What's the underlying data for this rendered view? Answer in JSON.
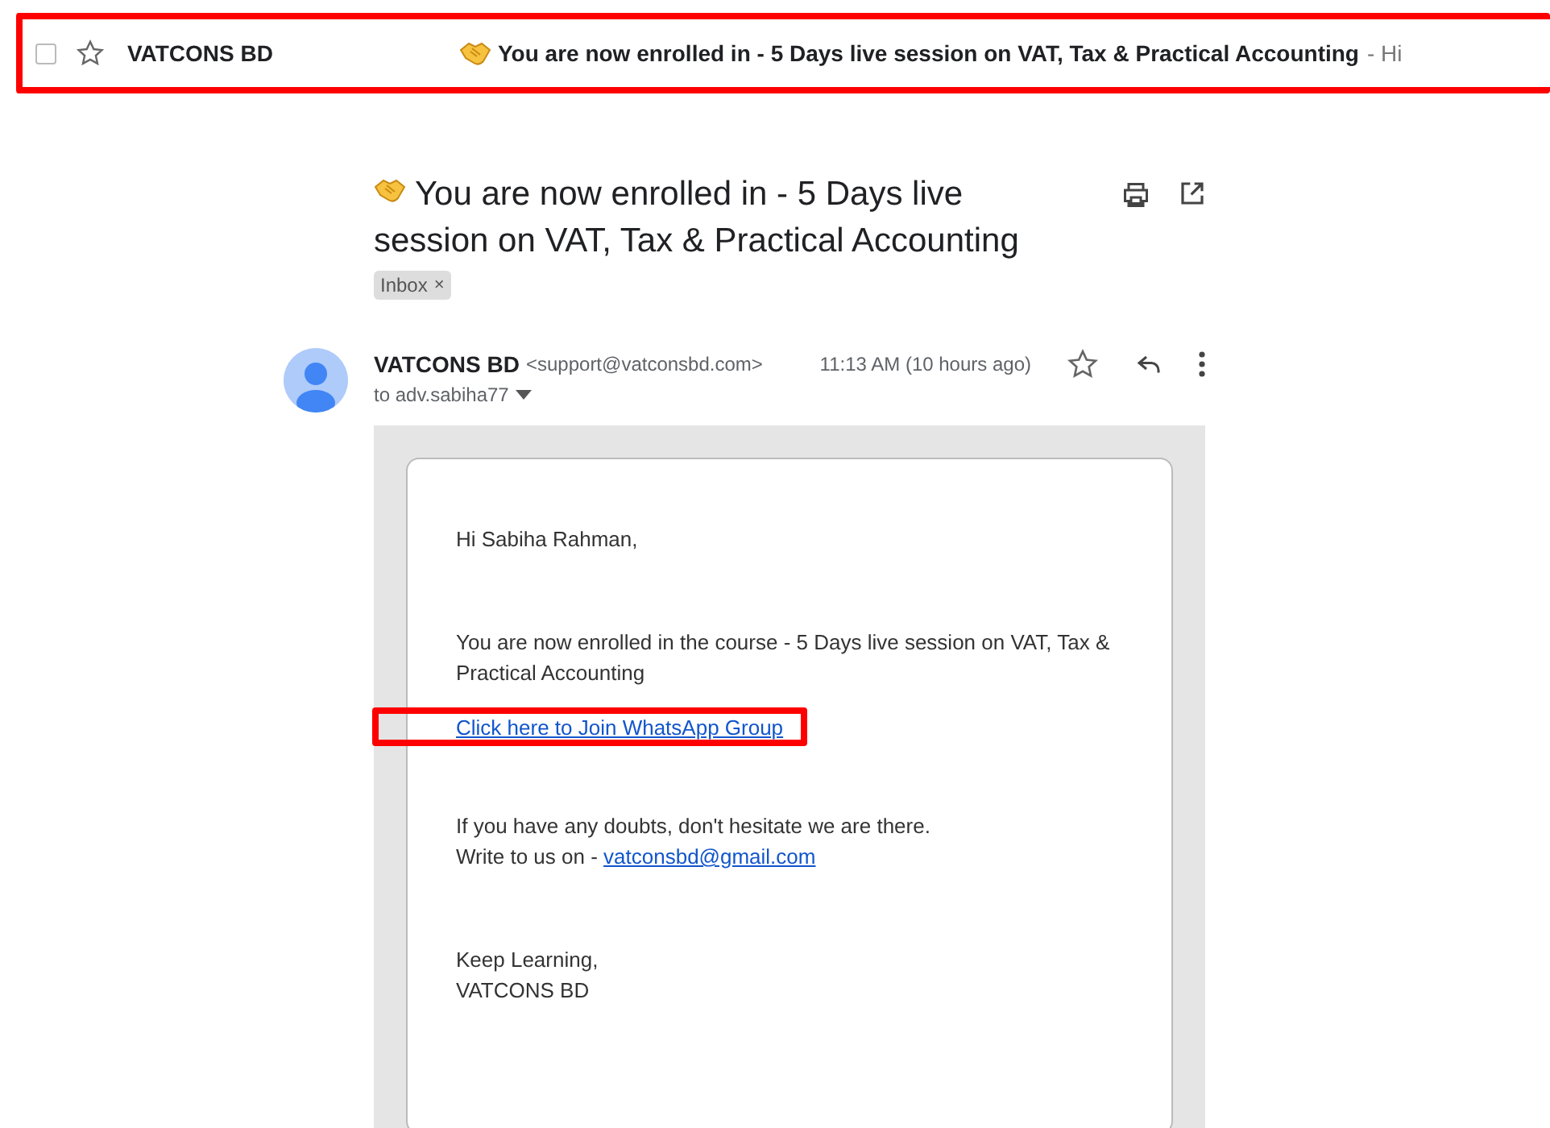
{
  "list_row": {
    "checked": false,
    "starred": false,
    "sender": "VATCONS BD",
    "subject": "You are now enrolled in - 5 Days live session on VAT, Tax & Practical Accounting",
    "snippet": "- Hi"
  },
  "message": {
    "subject": "You are now enrolled in - 5 Days live session on VAT, Tax & Practical Accounting",
    "labels": [
      {
        "name": "Inbox",
        "remove": "×"
      }
    ],
    "sender_name": "VATCONS BD",
    "sender_email": "<support@vatconsbd.com>",
    "time": "11:13 AM (10 hours ago)",
    "starred": false,
    "recipient": "to adv.sabiha77",
    "body": {
      "greeting": "Hi Sabiha Rahman,",
      "intro": "You are now enrolled in the course - 5 Days live session on VAT, Tax & Practical Accounting",
      "join_link": "Click here to Join WhatsApp Group",
      "doubts": "If you have any doubts, don't hesitate we are there.",
      "write_to": "Write to us on -",
      "contact_email": "vatconsbd@gmail.com",
      "closing": "Keep Learning,",
      "signature": "VATCONS BD"
    }
  }
}
